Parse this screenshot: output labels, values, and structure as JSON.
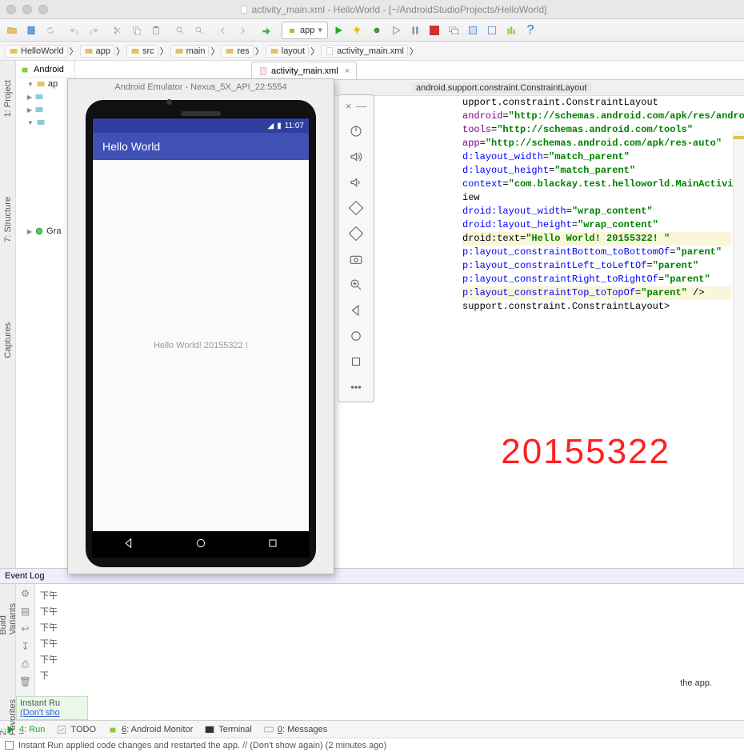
{
  "window": {
    "title": "activity_main.xml - HelloWorld - [~/AndroidStudioProjects/HelloWorld]"
  },
  "breadcrumb": [
    "HelloWorld",
    "app",
    "src",
    "main",
    "res",
    "layout",
    "activity_main.xml"
  ],
  "project": {
    "view_mode": "Android",
    "items": [
      "ap",
      "",
      "",
      "",
      "Gra"
    ]
  },
  "editor": {
    "tab_label": "activity_main.xml",
    "context_crumb": "android.support.constraint.ConstraintLayout",
    "code_lines": [
      {
        "t": "upport.constraint.ConstraintLayout",
        "cls": ""
      },
      {
        "t": "android=\"http://schemas.android.com/apk/res/android\"",
        "cls": "ln-schema",
        "pre": ""
      },
      {
        "t": "tools=\"http://schemas.android.com/tools\"",
        "cls": "ln-schema"
      },
      {
        "t": "app=\"http://schemas.android.com/apk/res-auto\"",
        "cls": "ln-schema"
      },
      {
        "t": "d:layout_width=\"match_parent\"",
        "cls": "ln-attr"
      },
      {
        "t": "d:layout_height=\"match_parent\"",
        "cls": "ln-attr"
      },
      {
        "t": "context=\"com.blackay.test.helloworld.MainActivity\">",
        "cls": "ln-ctx"
      },
      {
        "t": "",
        "cls": ""
      },
      {
        "t": "iew",
        "cls": ""
      },
      {
        "t": "droid:layout_width=\"wrap_content\"",
        "cls": "ln-attr2"
      },
      {
        "t": "droid:layout_height=\"wrap_content\"",
        "cls": "ln-attr2"
      },
      {
        "t": "droid:text=\"Hello World! 20155322! \"",
        "cls": "ln-hl"
      },
      {
        "t": "p:layout_constraintBottom_toBottomOf=\"parent\"",
        "cls": "ln-attr2"
      },
      {
        "t": "p:layout_constraintLeft_toLeftOf=\"parent\"",
        "cls": "ln-attr2"
      },
      {
        "t": "p:layout_constraintRight_toRightOf=\"parent\"",
        "cls": "ln-attr2"
      },
      {
        "t": "p:layout_constraintTop_toTopOf=\"parent\" />",
        "cls": "ln-attr2 ln-hl2"
      },
      {
        "t": "",
        "cls": ""
      },
      {
        "t": "support.constraint.ConstraintLayout>",
        "cls": ""
      }
    ]
  },
  "emulator": {
    "title": "Android Emulator - Nexus_5X_API_22:5554",
    "clock": "11:07",
    "app_title": "Hello World",
    "content_text": "Hello World! 20155322 !"
  },
  "overlay_number": "20155322",
  "run_config": {
    "label": "app"
  },
  "log": {
    "header": "Event Log",
    "rows": [
      "下午",
      "下午",
      "下午",
      "下午",
      "下午",
      "下"
    ],
    "fragment": "the app.",
    "instant_title": "Instant Ru",
    "instant_link": "(Don't sho"
  },
  "tool_windows": {
    "run": "4: Run",
    "todo": "TODO",
    "monitor": "6: Android Monitor",
    "terminal": "Terminal",
    "messages": "0: Messages"
  },
  "status": "Instant Run applied code changes and restarted the app. // (Don't show again) (2 minutes ago)"
}
